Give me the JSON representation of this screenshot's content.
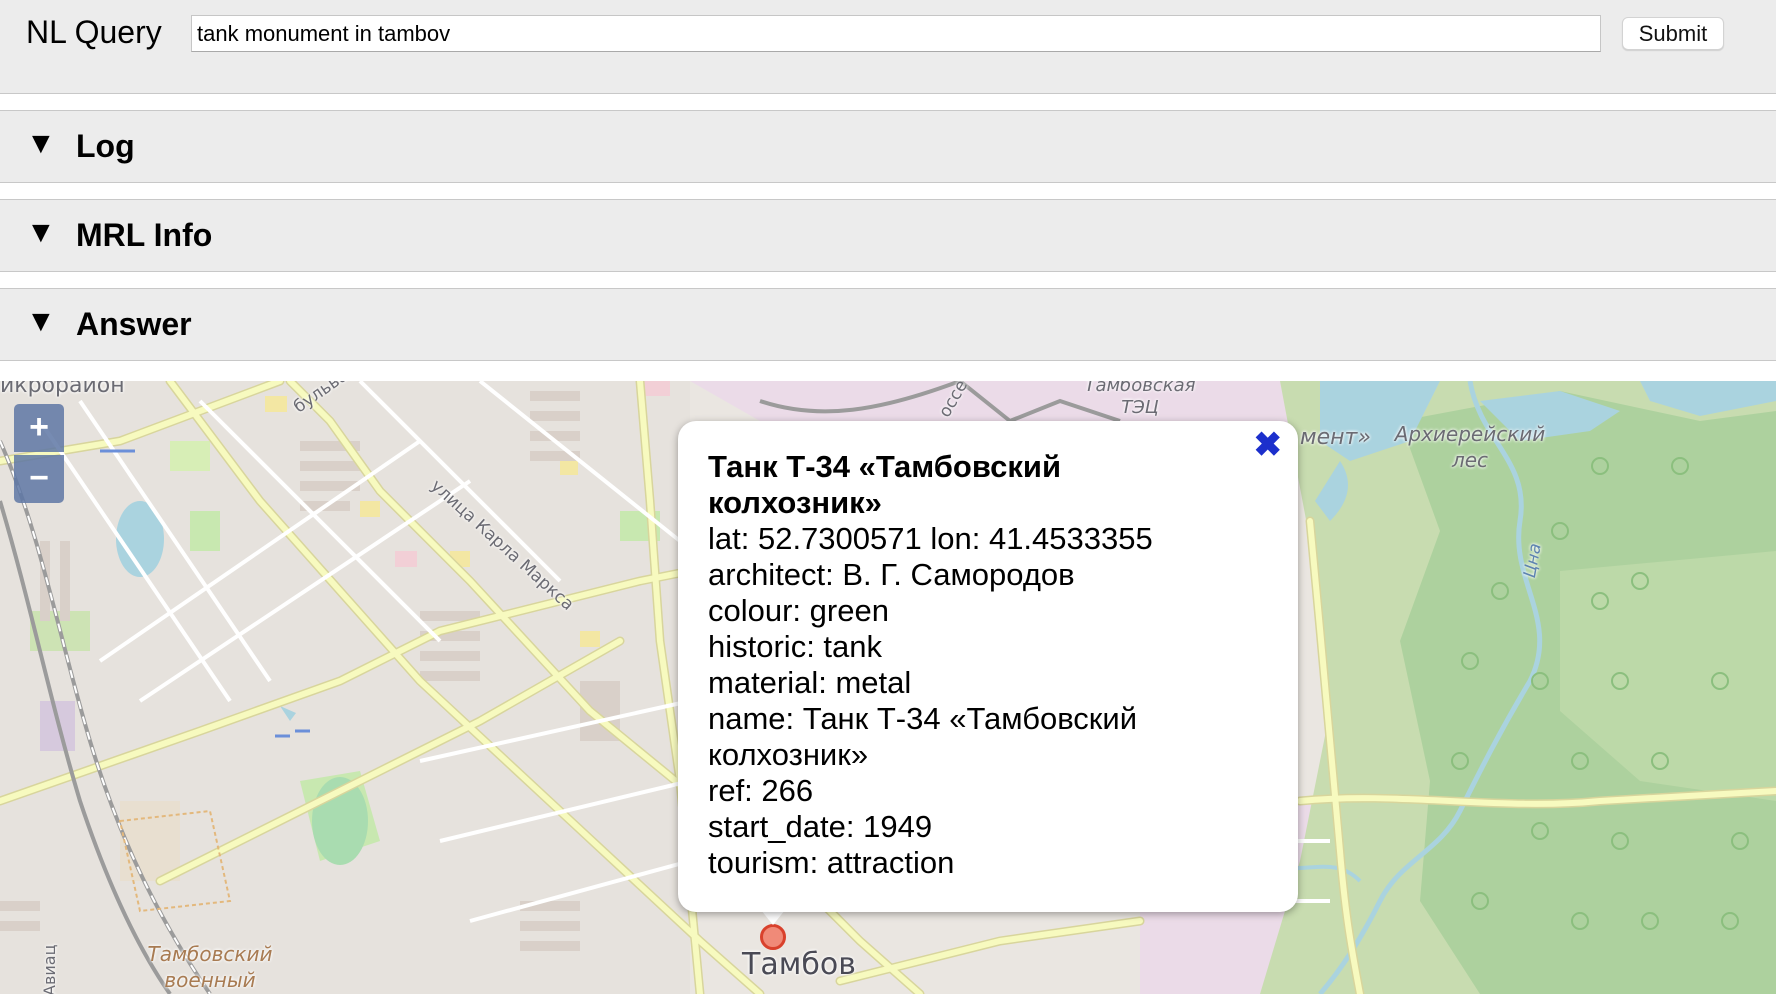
{
  "query": {
    "label": "NL Query",
    "value": "tank monument in tambov",
    "submit_label": "Submit"
  },
  "sections": [
    {
      "toggle_icon": "▼",
      "title": "Log"
    },
    {
      "toggle_icon": "▼",
      "title": "MRL Info"
    },
    {
      "toggle_icon": "▼",
      "title": "Answer"
    }
  ],
  "map": {
    "zoom_in_label": "+",
    "zoom_out_label": "−",
    "labels": {
      "microdistrict": "икрорайон",
      "bulvar": "бульвар Энт",
      "karla_marksa": "улица Карла Маркса",
      "tambovskaya_tets": "Тамбовская ТЭЦ",
      "monument": "мент»",
      "arkhiereysky": "Архиерейский лес",
      "tsna": "Цна",
      "tambov": "Тамбов",
      "military": "Тамбовский военный",
      "aviats": "Авиац",
      "osse": "оссе"
    },
    "popup": {
      "close_icon": "✖",
      "title": "Танк Т-34 «Тамбовский колхозник»",
      "properties": [
        "lat: 52.7300571 lon: 41.4533355",
        "architect: В. Г. Самородов",
        "colour: green",
        "historic: tank",
        "material: metal",
        "name: Танк Т-34 «Тамбовский колхозник»",
        "ref: 266",
        "start_date: 1949",
        "tourism: attraction"
      ]
    },
    "colors": {
      "land": "#efe9df",
      "forest": "#add19e",
      "forest_light": "#c8dcb0",
      "water": "#aad3df",
      "road": "#f7fabf",
      "road_edge": "#d8d59c",
      "railway": "#9b9b9b",
      "zoom_control": "#5e77a4",
      "marker": "#d9412c"
    }
  }
}
